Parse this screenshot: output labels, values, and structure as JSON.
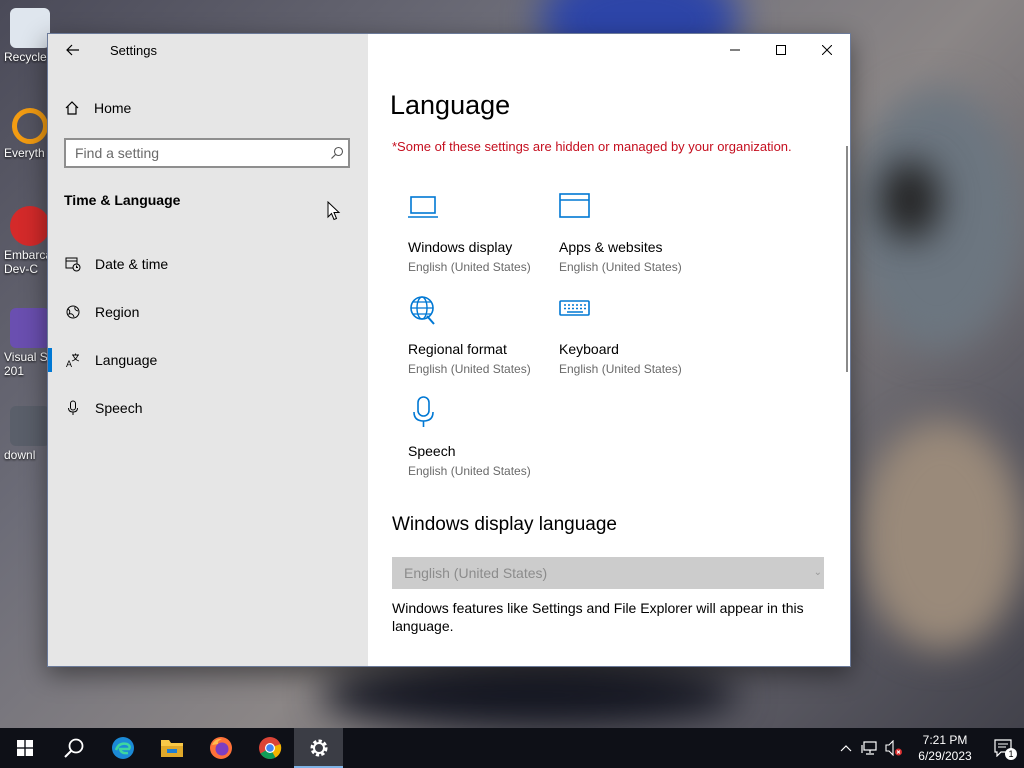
{
  "desktop": {
    "icons": [
      {
        "label": "Recycle",
        "icon": "recycle-bin-icon"
      },
      {
        "label": "Everyth",
        "icon": "everything-search-icon"
      },
      {
        "label": "Embarca",
        "label2": "Dev-C",
        "icon": "devcpp-icon"
      },
      {
        "label": "Visual S",
        "label2": "201",
        "icon": "visual-studio-icon"
      },
      {
        "label": "downl",
        "icon": "download-image-icon"
      }
    ]
  },
  "window": {
    "title": "Settings",
    "controls": {
      "minimize": "minimize-icon",
      "maximize": "maximize-icon",
      "close": "close-icon"
    }
  },
  "sidebar": {
    "home_label": "Home",
    "search_placeholder": "Find a setting",
    "section_title": "Time & Language",
    "items": [
      {
        "label": "Date & time",
        "icon": "clock-calendar-icon",
        "active": false
      },
      {
        "label": "Region",
        "icon": "globe-icon",
        "active": false
      },
      {
        "label": "Language",
        "icon": "language-icon",
        "active": true
      },
      {
        "label": "Speech",
        "icon": "microphone-icon",
        "active": false
      }
    ]
  },
  "main": {
    "title": "Language",
    "org_warning": "*Some of these settings are hidden or managed by your organization.",
    "tiles": [
      {
        "name": "Windows display",
        "sub": "English (United States)",
        "icon": "laptop-icon"
      },
      {
        "name": "Apps & websites",
        "sub": "English (United States)",
        "icon": "browser-window-icon"
      },
      {
        "name": "Regional format",
        "sub": "English (United States)",
        "icon": "globe-pin-icon"
      },
      {
        "name": "Keyboard",
        "sub": "English (United States)",
        "icon": "keyboard-icon"
      },
      {
        "name": "Speech",
        "sub": "English (United States)",
        "icon": "microphone-icon"
      }
    ],
    "display_language_heading": "Windows display language",
    "display_language_value": "English (United States)",
    "display_language_desc": "Windows features like Settings and File Explorer will appear in this language."
  },
  "taskbar": {
    "apps": [
      "start-icon",
      "search-icon",
      "edge-icon",
      "file-explorer-icon",
      "firefox-icon",
      "chrome-icon",
      "settings-icon"
    ],
    "time": "7:21 PM",
    "date": "6/29/2023",
    "notification_count": "1"
  },
  "colors": {
    "accent": "#0078d4",
    "warning": "#c50f1f",
    "sidebar_bg": "#e6e6e6",
    "taskbar_bg": "#0e1017"
  }
}
